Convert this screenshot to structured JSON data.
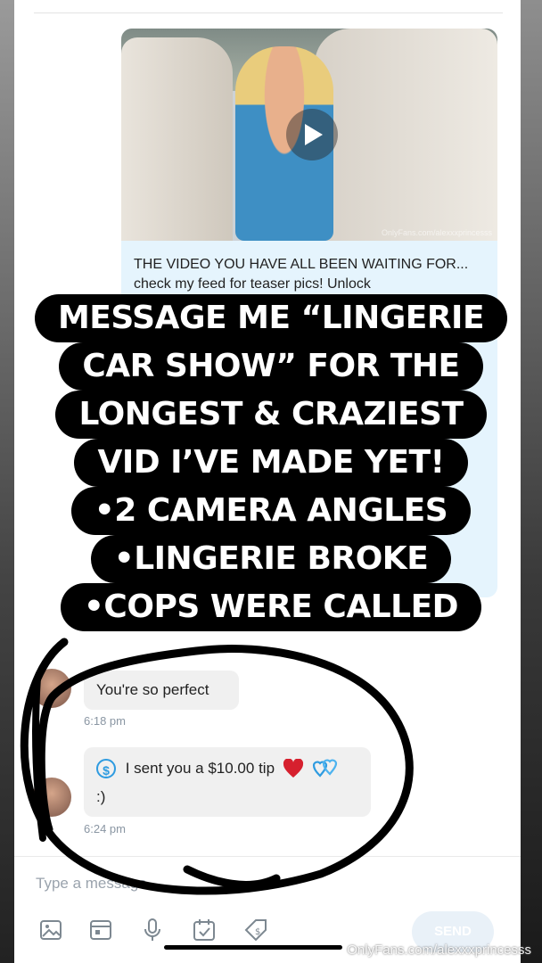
{
  "message_media": {
    "watermark": "OnlyFans.com/alexxxprincesss"
  },
  "message_caption": {
    "text": "THE VIDEO YOU HAVE ALL BEEN WAITING FOR... check my feed for teaser pics! Unlock"
  },
  "overlay": {
    "lines": [
      "MESSAGE ME “LINGERIE",
      "CAR SHOW” FOR THE",
      "LONGEST & CRAZIEST",
      "VID I’VE MADE YET!",
      "•2 CAMERA ANGLES",
      "•LINGERIE BROKE",
      "•COPS WERE CALLED"
    ]
  },
  "messages": [
    {
      "text": "You're so perfect",
      "time": "6:18 pm"
    },
    {
      "tip_text": "I sent you a $10.00 tip",
      "tip_symbol": "$",
      "text": ":)",
      "time": "6:24 pm"
    }
  ],
  "composer": {
    "placeholder": "Type a message",
    "send_label": "SEND"
  },
  "footer_watermark": "OnlyFans.com/alexxxprincesss",
  "colors": {
    "bubble_blue": "#e5f4fd",
    "accent": "#2e9be0",
    "heart": "#d6202e"
  }
}
